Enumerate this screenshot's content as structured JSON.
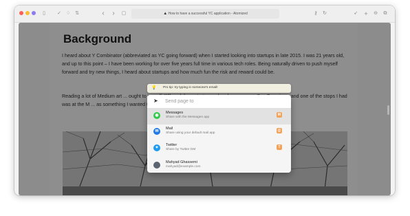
{
  "browser": {
    "url_title": "How to have a successful YC application - Atomized",
    "colors": {
      "close": "#fe5f57",
      "minimize": "#febc2e",
      "zoom": "#8c7cf0"
    }
  },
  "toolbar_icons": {
    "sidebar": "▯",
    "check": "✓",
    "shield": "♢",
    "translate": "⇅",
    "back": "‹",
    "forward": "›",
    "tab": "▢",
    "warning": "▲",
    "password": "⚷",
    "reload": "↻",
    "share": "➶",
    "new_tab": "+",
    "extension": "⊖",
    "tabs": "⧉"
  },
  "article": {
    "heading": "Background",
    "paragraphs": [
      "I heard about Y Combinator (abbreviated as YC going forward) when I started looking into startups in late 2015. I was 21 years old, and up to this point – I have been working for over five years full time in various tech roles. Being naturally driven to push myself forward and try new things, I heard about startups and how much fun the risk and reward could be.",
      "Reading a lot of Medium art ... ought to myself, \"I'll work for a startup and perhaps even ... San Francisco, and one of the stops I had was at the M ... as something I wanted to aim for."
    ]
  },
  "tip": {
    "icon": "💡",
    "text": "Pro tip: try typing in someone's email!"
  },
  "share_popup": {
    "send_icon": "➤",
    "placeholder": "Send page to",
    "items": [
      {
        "title": "Messages",
        "subtitle": "Share with the Messages app",
        "key": "M",
        "icon": "messages-icon",
        "color": "#2ec94b"
      },
      {
        "title": "Mail",
        "subtitle": "Share using your default mail app",
        "key": "@",
        "icon": "mail-icon",
        "color": "#1f7ae8"
      },
      {
        "title": "Twitter",
        "subtitle": "Share by Twitter DM",
        "key": "T",
        "icon": "twitter-icon",
        "color": "#1d9bf0"
      },
      {
        "title": "Mahyad Ghassemi",
        "subtitle": "mahyad@example.com",
        "key": "",
        "icon": "avatar",
        "color": "#5b6470"
      }
    ]
  }
}
